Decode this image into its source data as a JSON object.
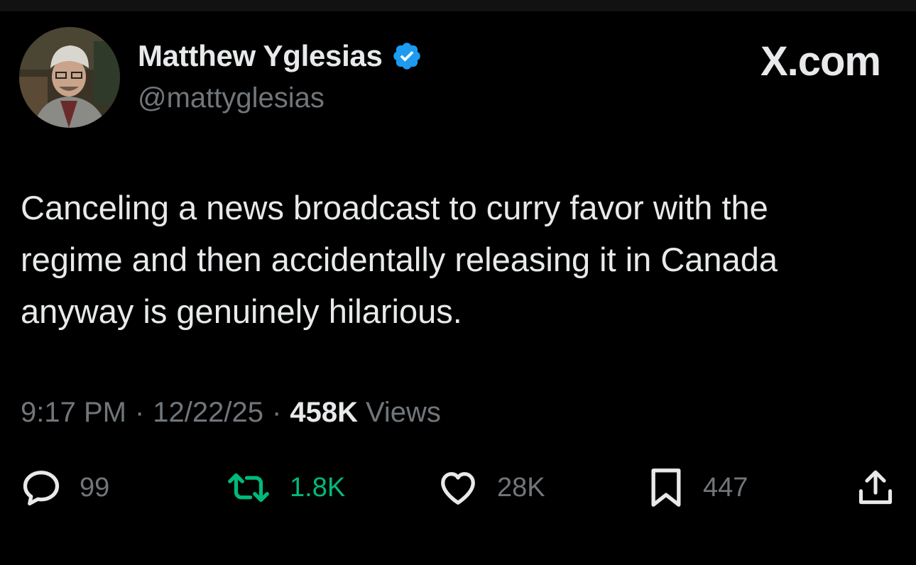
{
  "author": {
    "display_name": "Matthew Yglesias",
    "handle": "@mattyglesias",
    "verified": true
  },
  "brand": "X.com",
  "tweet": {
    "text": "Canceling a news broadcast to curry favor with the\nregime and then accidentally releasing it in Canada\nanyway is genuinely hilarious.",
    "time": "9:17 PM",
    "date": "12/22/25",
    "separator": "·",
    "views_count": "458K",
    "views_label": "Views"
  },
  "actions": {
    "replies": "99",
    "reposts": "1.8K",
    "likes": "28K",
    "bookmarks": "447"
  },
  "colors": {
    "background": "#000000",
    "text_primary": "#e7e9ea",
    "text_secondary": "#71767b",
    "verified_blue": "#1d9bf0",
    "repost_green": "#00ba7c"
  },
  "icons": {
    "reply": "reply-icon",
    "repost": "repost-icon",
    "like": "heart-icon",
    "bookmark": "bookmark-icon",
    "share": "share-icon",
    "verified": "verified-badge-icon"
  }
}
